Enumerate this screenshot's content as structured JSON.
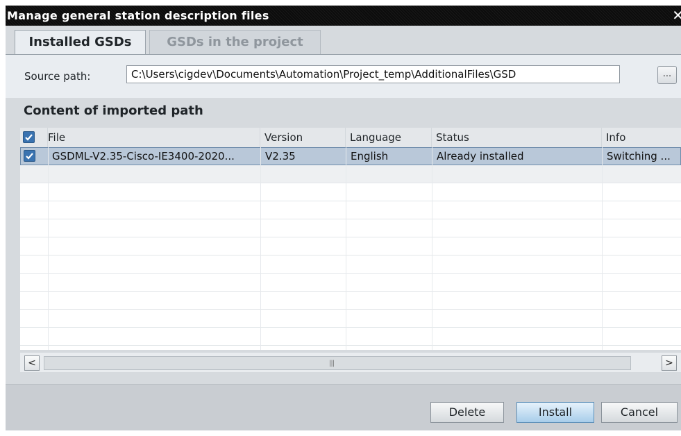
{
  "dialog": {
    "title": "Manage general station description files"
  },
  "tabs": [
    {
      "label": "Installed GSDs",
      "active": true
    },
    {
      "label": "GSDs in the project",
      "active": false
    }
  ],
  "source": {
    "label": "Source path:",
    "value": "C:\\Users\\cigdev\\Documents\\Automation\\Project_temp\\AdditionalFiles\\GSD",
    "browse_label": "..."
  },
  "content": {
    "title": "Content of imported path",
    "columns": [
      "File",
      "Version",
      "Language",
      "Status",
      "Info"
    ],
    "rows": [
      {
        "checked": true,
        "file": "GSDML-V2.35-Cisco-IE3400-2020...",
        "version": "V2.35",
        "language": "English",
        "status": "Already installed",
        "info": "Switching ..."
      }
    ]
  },
  "scrollbar": {
    "left_arrow": "<",
    "right_arrow": ">",
    "grip": "|||"
  },
  "buttons": {
    "delete": "Delete",
    "install": "Install",
    "cancel": "Cancel"
  },
  "colors": {
    "title_bar": "#0c0c0c",
    "selected_row": "#b9c8d9",
    "checkbox": "#3a73b0",
    "install_button": "#a8cdea"
  }
}
